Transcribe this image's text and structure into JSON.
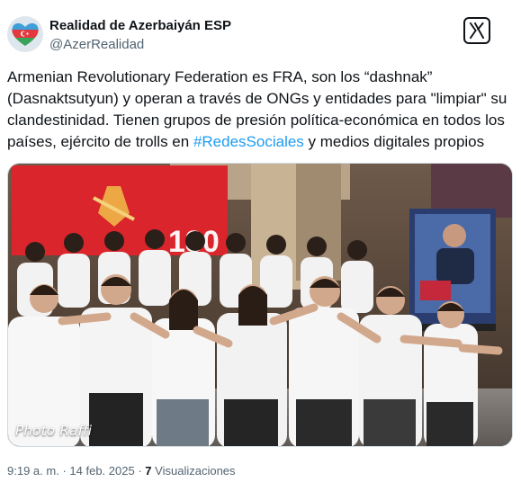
{
  "author": {
    "display_name": "Realidad de Azerbaiyán ESP",
    "handle": "@AzerRealidad",
    "avatar_icon": "azerbaijan-flag-heart-icon"
  },
  "brand_icon": "x-logo-icon",
  "tweet": {
    "text_part1": "Armenian Revolutionary Federation es FRA, son los “dashnak” (Dasnaktsutyun) y operan a través de ONGs y entidades para \"limpiar\" su clandestinidad. Tienen grupos de presión política-económica en todos los países, ejército de trolls en ",
    "hashtag": "#RedesSociales",
    "text_part2": " y medios digitales propios"
  },
  "photo": {
    "watermark": "Photo Raffi",
    "banner_number": "130"
  },
  "meta": {
    "time": "9:19 a. m.",
    "separator": "·",
    "date": "14 feb. 2025",
    "views_count": "7",
    "views_label": "Visualizaciones"
  },
  "colors": {
    "hashtag": "#1d9bf0",
    "secondary_text": "#536471",
    "primary_text": "#0f1419",
    "flag_blue": "#3f9fd9",
    "flag_red": "#e2393e",
    "flag_green": "#3aa35a"
  }
}
